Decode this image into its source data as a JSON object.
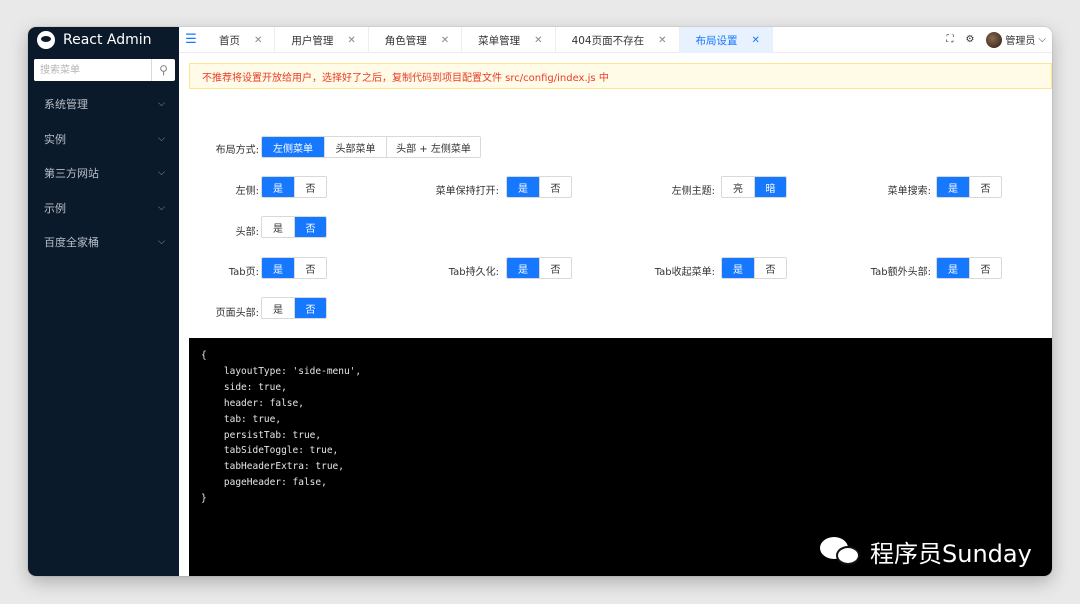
{
  "app": {
    "name": "React Admin"
  },
  "sidebar": {
    "search_placeholder": "搜索菜单",
    "items": [
      {
        "label": "系统管理"
      },
      {
        "label": "实例"
      },
      {
        "label": "第三方网站"
      },
      {
        "label": "示例"
      },
      {
        "label": "百度全家桶"
      }
    ]
  },
  "tabs": [
    {
      "label": "首页"
    },
    {
      "label": "用户管理"
    },
    {
      "label": "角色管理"
    },
    {
      "label": "菜单管理"
    },
    {
      "label": "404页面不存在"
    },
    {
      "label": "布局设置",
      "active": true
    }
  ],
  "header": {
    "user_name": "管理员"
  },
  "alert": {
    "text": "不推荐将设置开放给用户，选择好了之后，复制代码到项目配置文件 src/config/index.js 中"
  },
  "settings": {
    "layout": {
      "label": "布局方式:",
      "options": [
        "左侧菜单",
        "头部菜单",
        "头部 + 左侧菜单"
      ],
      "selected": 0
    },
    "side": {
      "label": "左侧:",
      "options": [
        "是",
        "否"
      ],
      "selected": 0
    },
    "keep_open": {
      "label": "菜单保持打开:",
      "options": [
        "是",
        "否"
      ],
      "selected": 0
    },
    "side_theme": {
      "label": "左侧主题:",
      "options": [
        "亮",
        "暗"
      ],
      "selected": 1
    },
    "menu_search": {
      "label": "菜单搜索:",
      "options": [
        "是",
        "否"
      ],
      "selected": 0
    },
    "header": {
      "label": "头部:",
      "options": [
        "是",
        "否"
      ],
      "selected": 1
    },
    "tab": {
      "label": "Tab页:",
      "options": [
        "是",
        "否"
      ],
      "selected": 0
    },
    "tab_persist": {
      "label": "Tab持久化:",
      "options": [
        "是",
        "否"
      ],
      "selected": 0
    },
    "tab_toggle": {
      "label": "Tab收起菜单:",
      "options": [
        "是",
        "否"
      ],
      "selected": 0
    },
    "tab_extra": {
      "label": "Tab额外头部:",
      "options": [
        "是",
        "否"
      ],
      "selected": 0
    },
    "page_header": {
      "label": "页面头部:",
      "options": [
        "是",
        "否"
      ],
      "selected": 1
    }
  },
  "code": {
    "lines": [
      "{",
      "    layoutType: 'side-menu',",
      "    side: true,",
      "    header: false,",
      "    tab: true,",
      "    persistTab: true,",
      "    tabSideToggle: true,",
      "    tabHeaderExtra: true,",
      "    pageHeader: false,",
      "}"
    ]
  },
  "watermark": {
    "text": "程序员Sunday"
  },
  "colors": {
    "primary": "#1677ff",
    "sidebar_bg": "#0b1a2b",
    "alert_text": "#e83c2a",
    "code_bg": "#000000"
  }
}
